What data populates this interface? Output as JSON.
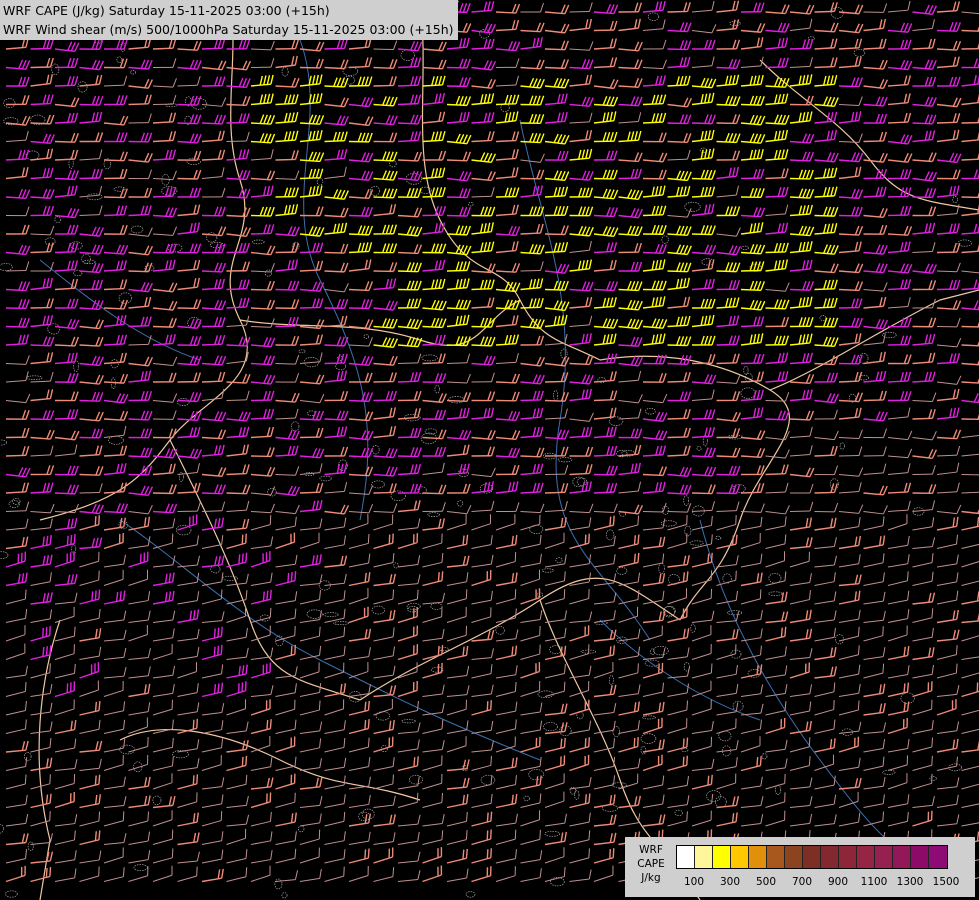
{
  "titles": {
    "line1": "WRF CAPE (J/kg) Saturday 15-11-2025 03:00 (+15h)",
    "line2": "WRF Wind shear (m/s) 500/1000hPa Saturday 15-11-2025 03:00 (+15h)"
  },
  "legend": {
    "model": "WRF",
    "field": "CAPE",
    "unit": "J/kg",
    "colors": [
      "#ffffff",
      "#fff59a",
      "#ffff00",
      "#ffc800",
      "#e0900a",
      "#a8581c",
      "#8c4420",
      "#7d2f26",
      "#82282e",
      "#8e2639",
      "#962444",
      "#96204f",
      "#92185a",
      "#8e0a68",
      "#8e0a74"
    ],
    "tick_labels": [
      "100",
      "300",
      "500",
      "700",
      "900",
      "1100",
      "1300",
      "1500"
    ]
  },
  "barb_colors": {
    "weak": "#c09090",
    "moderate": "#ee8a78",
    "strong": "#e020e0",
    "extreme": "#ffff00"
  },
  "map_colors": {
    "background": "#000000",
    "borders": "#f0c8a0",
    "rivers": "#3d6fb0",
    "terrain_contours": "#a8a8a8"
  }
}
